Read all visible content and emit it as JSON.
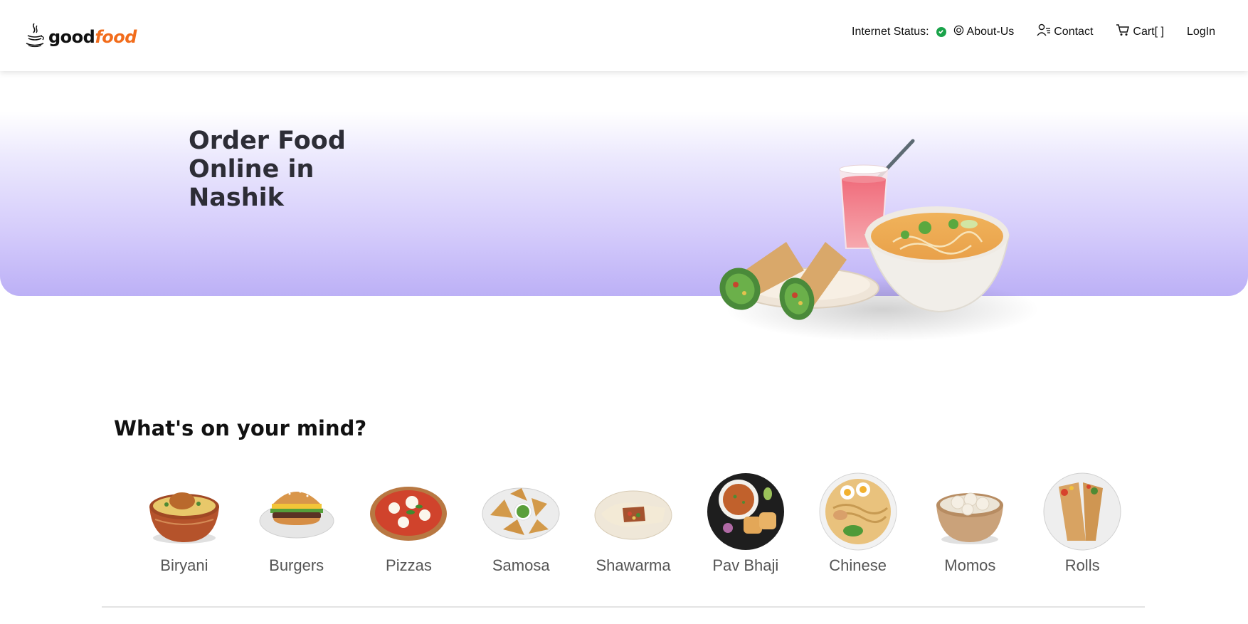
{
  "brand": {
    "good": "good",
    "food": "food"
  },
  "nav": {
    "internet_status_label": "Internet Status:",
    "internet_status_icon": "check-circle-icon",
    "about": "About-Us",
    "contact": "Contact",
    "cart": "Cart[ ]",
    "login": "LogIn"
  },
  "hero": {
    "title": "Order Food Online in Nashik"
  },
  "section": {
    "title": "What's on your mind?"
  },
  "categories": [
    {
      "label": "Biryani"
    },
    {
      "label": "Burgers"
    },
    {
      "label": "Pizzas"
    },
    {
      "label": "Samosa"
    },
    {
      "label": "Shawarma"
    },
    {
      "label": "Pav Bhaji"
    },
    {
      "label": "Chinese"
    },
    {
      "label": "Momos"
    },
    {
      "label": "Rolls"
    }
  ],
  "colors": {
    "brand_accent": "#f26c1b",
    "status_ok": "#1aa34a",
    "hero_gradient_end": "#bcb0f6"
  }
}
